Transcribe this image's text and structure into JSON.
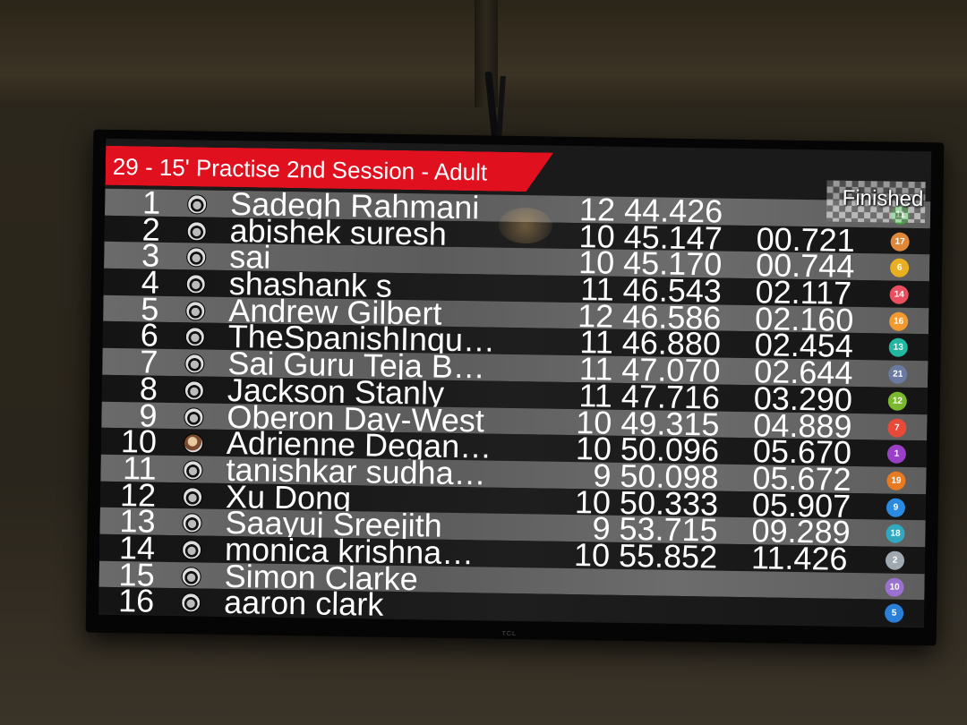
{
  "session_title": "29 - 15' Practise 2nd Session - Adult",
  "status": "Finished",
  "colors": {
    "title_bar": "#e0101e",
    "text": "#ffffff"
  },
  "icons": {
    "kart_avatar": "helmet-avatar-icon",
    "finish": "checkered-flag-icon"
  },
  "tv_brand": "TCL",
  "results": [
    {
      "pos": "1",
      "name": "Sadegh Rahmani",
      "laps": "12",
      "best": "44.426",
      "gap": "",
      "kart": "11",
      "kart_color": "#3aa63a"
    },
    {
      "pos": "2",
      "name": "abishek suresh",
      "laps": "10",
      "best": "45.147",
      "gap": "00.721",
      "kart": "17",
      "kart_color": "#e0883a"
    },
    {
      "pos": "3",
      "name": "sai",
      "laps": "10",
      "best": "45.170",
      "gap": "00.744",
      "kart": "6",
      "kart_color": "#e8b020"
    },
    {
      "pos": "4",
      "name": "shashank s",
      "laps": "11",
      "best": "46.543",
      "gap": "02.117",
      "kart": "14",
      "kart_color": "#e85060"
    },
    {
      "pos": "5",
      "name": "Andrew Gilbert",
      "laps": "12",
      "best": "46.586",
      "gap": "02.160",
      "kart": "16",
      "kart_color": "#f09a30"
    },
    {
      "pos": "6",
      "name": "TheSpanishInqu…",
      "laps": "11",
      "best": "46.880",
      "gap": "02.454",
      "kart": "13",
      "kart_color": "#20b8a0"
    },
    {
      "pos": "7",
      "name": "Sai Guru Teja B…",
      "laps": "11",
      "best": "47.070",
      "gap": "02.644",
      "kart": "21",
      "kart_color": "#6a7aa0"
    },
    {
      "pos": "8",
      "name": "Jackson Stanly",
      "laps": "11",
      "best": "47.716",
      "gap": "03.290",
      "kart": "12",
      "kart_color": "#7ab830"
    },
    {
      "pos": "9",
      "name": "Oberon Day-West",
      "laps": "10",
      "best": "49.315",
      "gap": "04.889",
      "kart": "7",
      "kart_color": "#e84a3a"
    },
    {
      "pos": "10",
      "name": "Adrienne Degan…",
      "laps": "10",
      "best": "50.096",
      "gap": "05.670",
      "kart": "1",
      "kart_color": "#9a40c8",
      "photo": true
    },
    {
      "pos": "11",
      "name": "tanishkar sudha…",
      "laps": "9",
      "best": "50.098",
      "gap": "05.672",
      "kart": "19",
      "kart_color": "#e87a20"
    },
    {
      "pos": "12",
      "name": "Xu Dong",
      "laps": "10",
      "best": "50.333",
      "gap": "05.907",
      "kart": "9",
      "kart_color": "#2a8ae0"
    },
    {
      "pos": "13",
      "name": "Saayuj Sreejith",
      "laps": "9",
      "best": "53.715",
      "gap": "09.289",
      "kart": "18",
      "kart_color": "#30a8c0"
    },
    {
      "pos": "14",
      "name": "monica krishna…",
      "laps": "10",
      "best": "55.852",
      "gap": "11.426",
      "kart": "2",
      "kart_color": "#a0a8b0"
    },
    {
      "pos": "15",
      "name": "Simon Clarke",
      "laps": "",
      "best": "",
      "gap": "",
      "kart": "10",
      "kart_color": "#9a70d0"
    },
    {
      "pos": "16",
      "name": "aaron clark",
      "laps": "",
      "best": "",
      "gap": "",
      "kart": "5",
      "kart_color": "#2a80d8"
    }
  ]
}
